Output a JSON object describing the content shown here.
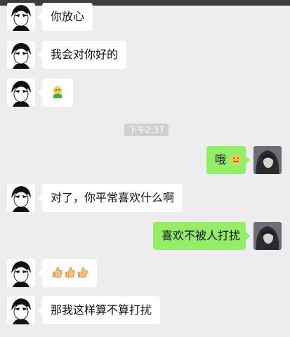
{
  "timestamp": "下午2:37",
  "messages": [
    {
      "side": "in",
      "text": "你放心"
    },
    {
      "side": "in",
      "text": "我会对你好的"
    },
    {
      "side": "in",
      "text": "",
      "emoji": "baby-emoji"
    },
    {
      "side": "out",
      "text": "哦",
      "emoji": "smile-emoji"
    },
    {
      "side": "in",
      "text": "对了，你平常喜欢什么啊"
    },
    {
      "side": "out",
      "text": "喜欢不被人打扰"
    },
    {
      "side": "in",
      "text": "",
      "emoji": "thumbs-up-emoji x3"
    },
    {
      "side": "in",
      "text": "那我这样算不算打扰"
    }
  ],
  "colors": {
    "background": "#ededed",
    "incoming_bubble": "#ffffff",
    "outgoing_bubble": "#95ec69",
    "timestamp_bg": "#cfcfcf"
  }
}
